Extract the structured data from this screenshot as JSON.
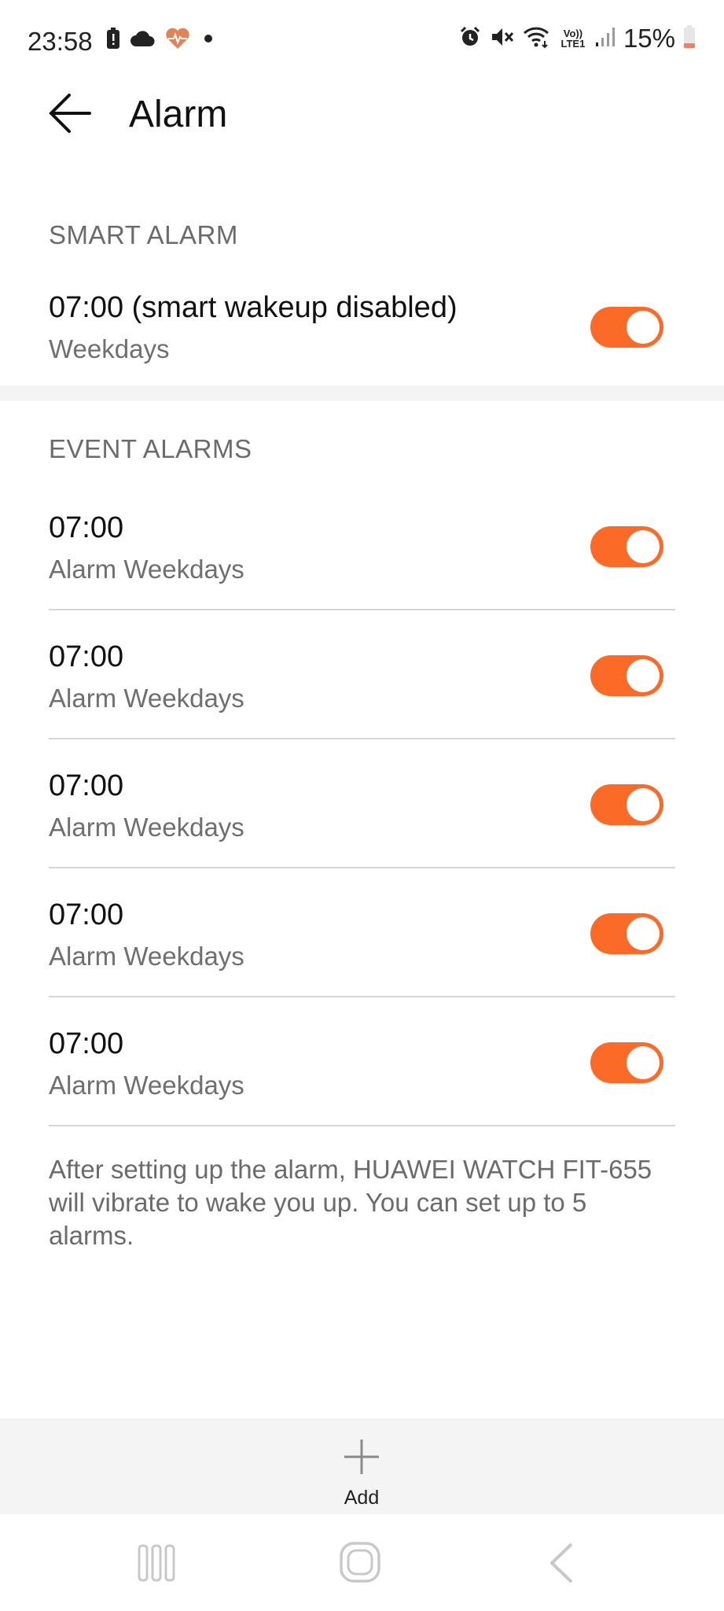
{
  "status_bar": {
    "time": "23:58",
    "battery": "15%",
    "left_icons": [
      "battery-alert-icon",
      "cloud-icon",
      "health-heart-icon",
      "dot-icon"
    ],
    "right_icons": [
      "alarm-icon",
      "mute-icon",
      "wifi-icon",
      "volte-icon",
      "signal-icon",
      "battery-icon"
    ],
    "volte_label": "Vo))",
    "lte_label": "LTE1"
  },
  "header": {
    "title": "Alarm"
  },
  "smart_alarm": {
    "section_title": "SMART ALARM",
    "item": {
      "time": "07:00 (smart wakeup disabled)",
      "repeat": "Weekdays",
      "enabled": true
    }
  },
  "event_alarms": {
    "section_title": "EVENT ALARMS",
    "items": [
      {
        "time": "07:00",
        "label": "Alarm Weekdays",
        "enabled": true
      },
      {
        "time": "07:00",
        "label": "Alarm Weekdays",
        "enabled": true
      },
      {
        "time": "07:00",
        "label": "Alarm Weekdays",
        "enabled": true
      },
      {
        "time": "07:00",
        "label": "Alarm Weekdays",
        "enabled": true
      },
      {
        "time": "07:00",
        "label": "Alarm Weekdays",
        "enabled": true
      }
    ]
  },
  "note": "After setting up the alarm, HUAWEI WATCH FIT-655 will vibrate to wake you up. You can set up to 5 alarms.",
  "bottom_bar": {
    "add_label": "Add"
  },
  "colors": {
    "accent": "#fb6a26",
    "band": "#f4f4f4",
    "secondary_text": "#6b6b6b"
  },
  "nav_bar": [
    "recent-apps-icon",
    "home-icon",
    "back-icon"
  ]
}
